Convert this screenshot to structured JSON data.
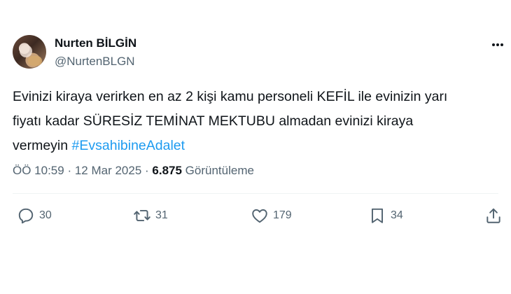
{
  "author": {
    "name": "Nurten BİLGİN",
    "handle": "@NurtenBLGN"
  },
  "tweet": {
    "text_line1": "Evinizi kiraya verirken en az 2 kişi kamu personeli KEFİL ile evinizin yarı",
    "text_line2": "fiyatı kadar SÜRESİZ TEMİNAT MEKTUBU almadan evinizi kiraya",
    "text_line3_prefix": "vermeyin ",
    "hashtag": "#EvsahibineAdalet",
    "time": "ÖÖ 10:59",
    "separator": " · ",
    "date": "12 Mar 2025",
    "views": "6.875",
    "views_label": "Görüntüleme"
  },
  "actions": {
    "reply_count": "30",
    "retweet_count": "31",
    "like_count": "179",
    "bookmark_count": "34"
  },
  "icons": {
    "more": "more-dots-icon",
    "reply": "reply-icon",
    "retweet": "retweet-icon",
    "like": "heart-icon",
    "bookmark": "bookmark-icon",
    "share": "share-icon"
  },
  "colors": {
    "text": "#0f1419",
    "secondary": "#536471",
    "link": "#1d9bf0",
    "divider": "#eff3f4"
  }
}
